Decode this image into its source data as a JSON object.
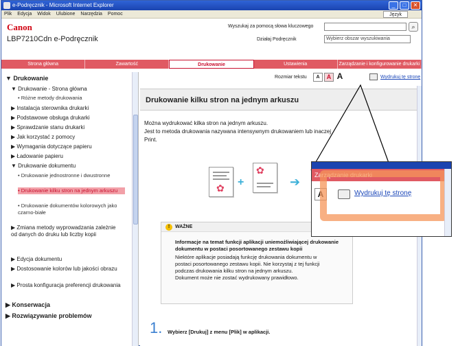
{
  "window": {
    "title": "e-Podręcznik - Microsoft Internet Explorer",
    "menu": [
      "Plik",
      "Edycja",
      "Widok",
      "Ulubione",
      "Narzędzia",
      "Pomoc"
    ],
    "lang_button": "Język",
    "controls": {
      "minimize": "_",
      "maximize": "□",
      "close": "✕"
    }
  },
  "header": {
    "logo": "Canon",
    "product": "LBP7210Cdn  e-Podręcznik",
    "search_label": "Wyszukaj za pomocą słowa kluczowego",
    "area_label": "Działaj Podręcznik",
    "area_select": "Wybierz obszar wyszukiwania"
  },
  "nav": {
    "tabs": [
      {
        "label": "Strona główna",
        "active": false
      },
      {
        "label": "Zawartość",
        "active": false
      },
      {
        "label": "Drukowanie",
        "active": true
      },
      {
        "label": "Ustawienia",
        "active": false
      },
      {
        "label": "Zarządzanie i konfigurowanie drukarki",
        "active": false
      }
    ]
  },
  "sidebar": {
    "items": [
      {
        "text": "▼ Drukowanie",
        "level": 0,
        "bold": true
      },
      {
        "text": "▼ Drukowanie - Strona główna",
        "level": 1
      },
      {
        "text": "• Różne metody drukowania",
        "level": 2
      },
      {
        "text": "▶ Instalacja sterownika drukarki",
        "level": 1
      },
      {
        "text": "▶ Podstawowe obsługa drukarki",
        "level": 1
      },
      {
        "text": "▶ Sprawdzanie stanu drukarki",
        "level": 1
      },
      {
        "text": "▶ Jak korzystać z pomocy",
        "level": 1
      },
      {
        "text": "▶ Wymagania dotyczące papieru",
        "level": 1
      },
      {
        "text": "▶ Ładowanie papieru",
        "level": 1
      },
      {
        "text": "▼ Drukowanie dokumentu",
        "level": 1
      },
      {
        "text": "• Drukowanie jednostronne i dwustronne",
        "level": 2
      },
      {
        "text": "• Drukowanie kilku stron na jednym arkuszu",
        "level": 2,
        "selected": true
      },
      {
        "text": "• Drukowanie dokumentów kolorowych jako czarno-białe",
        "level": 2
      },
      {
        "text": "▶ Zmiana metody wyprowadzania zależnie od danych do druku lub liczby kopii",
        "level": 1
      },
      {
        "text": "▶ Edycja dokumentu",
        "level": 1
      },
      {
        "text": "▶ Dostosowanie kolorów lub jakości obrazu",
        "level": 1
      },
      {
        "text": "▶ Prosta konfiguracja preferencji drukowania",
        "level": 1
      },
      {
        "text": "▶ Konserwacja",
        "level": 0,
        "bold": true
      },
      {
        "text": "▶ Rozwiązywanie problemów",
        "level": 0,
        "bold": true
      }
    ]
  },
  "main": {
    "font_size_label": "Rozmiar tekstu",
    "font_sizes": [
      "A",
      "A",
      "A"
    ],
    "print_link": "Wydrukuj tę stronę",
    "title": "Drukowanie kilku stron na jednym arkuszu",
    "intro": [
      "Można wydrukować kilka stron na jednym arkuszu.",
      "Jest to metoda drukowania nazywana intensywnym drukowaniem lub inaczej",
      "Print."
    ],
    "important": {
      "label": "WAŻNE",
      "lines": [
        {
          "text": "Informacje na temat funkcji aplikacji uniemożliwiającej drukowanie",
          "bold": true
        },
        {
          "text": "dokumentu w postaci posortowanego zestawu kopii",
          "bold": true
        },
        {
          "text": "Niektóre aplikacje posiadają funkcję drukowania dokumentu w",
          "bold": false
        },
        {
          "text": "postaci posortowanego zestawu kopii. Nie korzystaj z tej funkcji",
          "bold": false
        },
        {
          "text": "podczas drukowania kilku stron na jednym arkuszu.",
          "bold": false
        },
        {
          "text": "Dokument może nie zostać wydrukowany prawidłowo.",
          "bold": false
        }
      ]
    },
    "step": {
      "number": "1.",
      "text": "Wybierz [Drukuj] z menu [Plik] w aplikacji."
    }
  },
  "zoom": {
    "tab_text": "Zarządzanie drukarki",
    "a_label": "A",
    "print_link": "Wydrukuj tę stronę"
  },
  "colors": {
    "nav_bg": "#e05a63",
    "accent_red": "#c8102e",
    "link_blue": "#1a46b8",
    "highlight_orange": "#f6965a"
  }
}
